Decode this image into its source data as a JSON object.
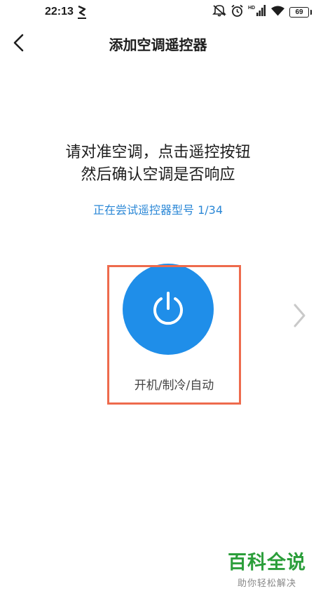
{
  "status_bar": {
    "time": "22:13",
    "battery": "69",
    "signal_label": "HD",
    "icons": [
      "carrier-logo-icon",
      "mute-icon",
      "alarm-icon",
      "hd-signal-icon",
      "wifi-icon",
      "battery-icon"
    ]
  },
  "header": {
    "title": "添加空调遥控器",
    "back_icon": "chevron-left-icon"
  },
  "instruction": {
    "line1": "请对准空调，点击遥控按钮",
    "line2": "然后确认空调是否响应"
  },
  "model_status": {
    "text": "正在尝试遥控器型号 1/34"
  },
  "remote_button": {
    "icon": "power-icon",
    "label": "开机/制冷/自动"
  },
  "navigation": {
    "next_icon": "chevron-right-icon"
  },
  "watermark": {
    "main": "百科全说",
    "sub": "助你轻松解决"
  },
  "colors": {
    "accent": "#1f8ee9",
    "link": "#2a87d6",
    "highlight": "#ee6b4d",
    "watermark": "#2b9e3a"
  }
}
